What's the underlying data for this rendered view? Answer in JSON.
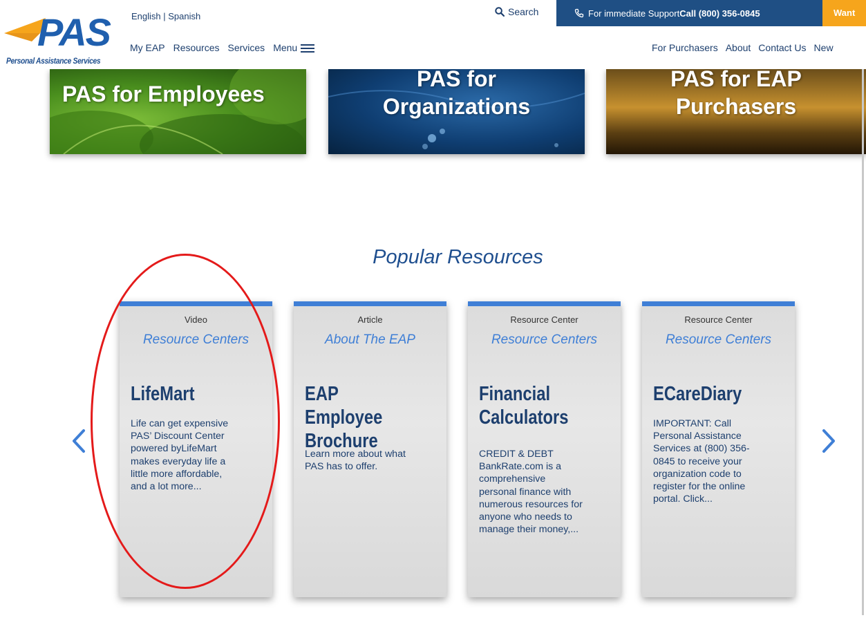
{
  "header": {
    "logo_text": "PAS",
    "logo_tagline": "Personal Assistance Services",
    "lang_english": "English",
    "lang_separator": " | ",
    "lang_spanish": "Spanish",
    "search_label": "Search",
    "support_text": "For immediate Support",
    "support_call": "Call (800) 356-0845",
    "want_label": "Want",
    "nav_left": [
      "My EAP",
      "Resources",
      "Services",
      "Menu"
    ],
    "nav_right": [
      "For Purchasers",
      "About",
      "Contact Us",
      "New"
    ]
  },
  "hero_tiles": [
    {
      "title_line1": "PAS for Employees",
      "title_line2": ""
    },
    {
      "title_line1": "PAS for",
      "title_line2": "Organizations"
    },
    {
      "title_line1": "PAS for EAP",
      "title_line2": "Purchasers"
    }
  ],
  "section": {
    "title": "Popular Resources"
  },
  "cards": [
    {
      "type": "Video",
      "category": "Resource Centers",
      "title_line1": "LifeMart",
      "title_line2": "",
      "desc_lines": [
        "Life can get expensive",
        "PAS’ Discount Center",
        "powered byLifeMart",
        "makes everyday life a",
        "little more affordable,",
        "and a lot more..."
      ]
    },
    {
      "type": "Article",
      "category": "About The EAP",
      "title_line1": "EAP Employee",
      "title_line2": "Brochure",
      "desc_lines": [
        "Learn more about what",
        "PAS has to offer."
      ]
    },
    {
      "type": "Resource Center",
      "category": "Resource Centers",
      "title_line1": "Financial",
      "title_line2": "Calculators",
      "desc_lines": [
        "CREDIT & DEBT",
        "BankRate.com  is a",
        "comprehensive",
        "personal finance with",
        "numerous resources for",
        "anyone who needs to",
        "manage their money,..."
      ]
    },
    {
      "type": "Resource Center",
      "category": "Resource Centers",
      "title_line1": "ECareDiary",
      "title_line2": "",
      "desc_lines": [
        "IMPORTANT: Call",
        "Personal Assistance",
        "Services at (800) 356-",
        "0845 to receive your",
        "organization code to",
        "register for the online",
        "portal. Click..."
      ]
    }
  ],
  "colors": {
    "brand_blue": "#1d3f6e",
    "accent_blue": "#3f7fd6",
    "support_bar": "#1f4f84",
    "want_orange": "#f6a51c",
    "highlight_red": "#e41a1a"
  },
  "icons": {
    "search": "search-icon",
    "phone": "phone-icon",
    "menu": "hamburger-icon",
    "prev": "chevron-left-icon",
    "next": "chevron-right-icon"
  }
}
